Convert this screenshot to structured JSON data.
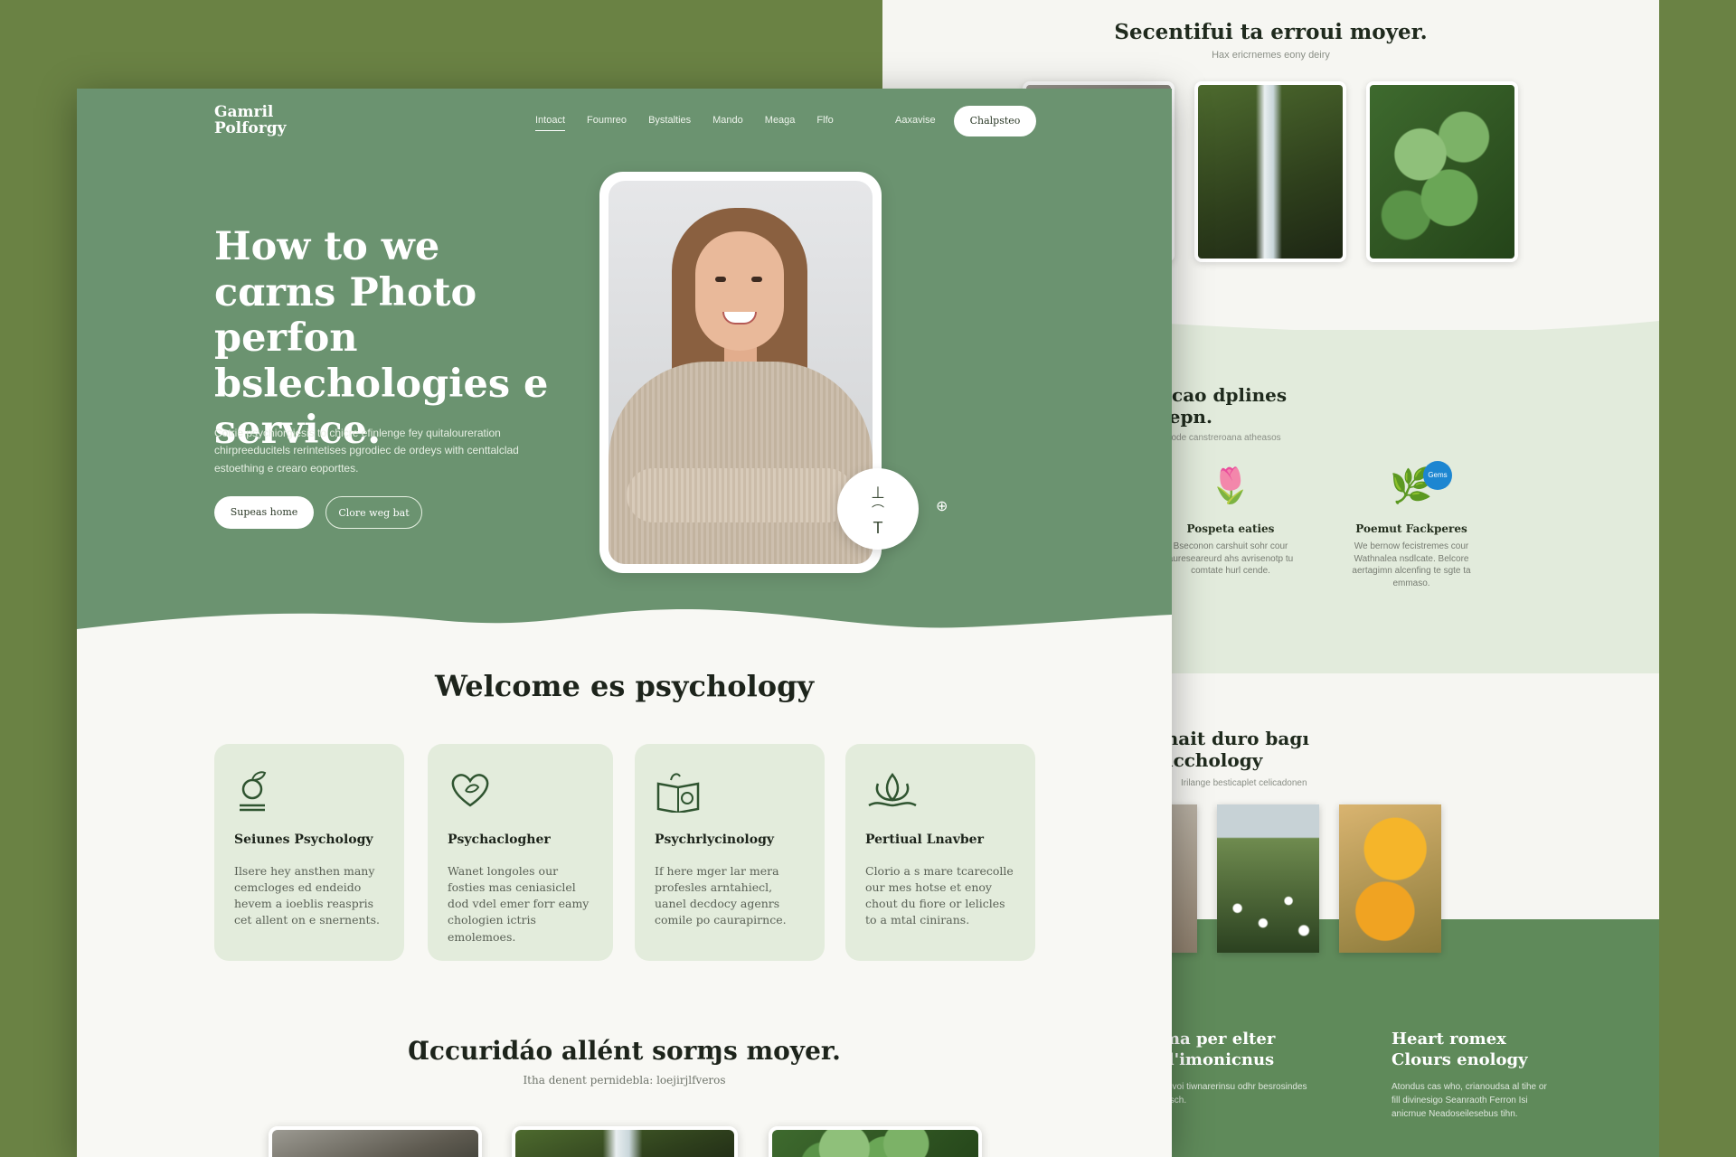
{
  "back": {
    "top_heading": "Secentifui ta erroui moyer.",
    "top_sub": "Hax ericrnemes eony deiry",
    "mid_heading": "ounicao dplines Erolepn.",
    "mid_sub": "Etode canstreroana atheasos",
    "features": [
      {
        "title": "Pospeta eaties",
        "text": "Bseconon carshuit sohr cour aureseareurd ahs avrisenotp tu comtate hurl cende.",
        "icon": "flower-icon"
      },
      {
        "title": "Poemut Fackperes",
        "text": "We bernow fecistremes cour Wathnalea nsdlcate. Belcore aertagimn alcenfing te sgte ta emmaso.",
        "icon": "leaf-icon",
        "badge": "Gems"
      }
    ],
    "bottom_heading": "enait duro bagı facchology",
    "bottom_sub": "Irilange besticaplet celicadonen",
    "foot_left_title": "ma per elter d'imonicnus",
    "foot_left_text": "Lsvoi tiwnarerinsu odhr besrosindes bisch.",
    "foot_right_title": "Heart romex Clours enology",
    "foot_right_text": "Atondus cas who, crianoudsa al tihe or fill divinesigo Seanraoth Ferron Isi anicrnue Neadoseilesebus tihn."
  },
  "front": {
    "logo": "Gamril Polforgy",
    "nav": [
      "Intoact",
      "Foumreo",
      "Bystalties",
      "Mando",
      "Meaga",
      "Flfo"
    ],
    "nav_extra": "Aaxavise",
    "nav_cta": "Chalpsteo",
    "hero_title": "How to we cɑrns Photo perfon bslechologies e service.",
    "hero_desc": "Cotrie psychiorgiesis to chicre efinlenge fey quitaloureration chirpreeducitels rerintetises pgrodiec de ordeys with centtalclad estoething e crearo eoporttes.",
    "btn_primary": "Supeas home",
    "btn_secondary": "Clore weg bat",
    "badge_top": "⊥",
    "badge_bottom": "T",
    "welcome_title": "Welcome es psychology",
    "cards": [
      {
        "title": "Seiunes Psychology",
        "text": "Ilsere hey ansthen many cemcloges ed endeido hevem a ioeblis reaspris cet allent on e snernents.",
        "icon": "growth-globe-icon"
      },
      {
        "title": "Psychaclogher",
        "text": "Wanet longoles our fosties mas ceniasiclel dod vdel emer forr eamy chologien ictris emolemoes.",
        "icon": "heart-leaf-icon"
      },
      {
        "title": "Psychrlycinology",
        "text": "If here mger lar mera profesles arntahiecl, uanel decdocy agenrs comile po caurapirnce.",
        "icon": "open-book-icon"
      },
      {
        "title": "Pertiual Lnavber",
        "text": "Clorio a s mare tcarecolle our mes hotse et enoy chout du fiore or lelicles to a mtal cinirans.",
        "icon": "lotus-icon"
      }
    ],
    "section3_title": "Ɑccuridáo allént sorɱs moyer.",
    "section3_sub": "Itha denent pernidebla: loejirjlfveros"
  },
  "colors": {
    "outer_bg": "#6a8244",
    "hero_green": "#6b9370",
    "card_bg": "#e3ecdc",
    "band_bg": "#e2ebdc"
  }
}
